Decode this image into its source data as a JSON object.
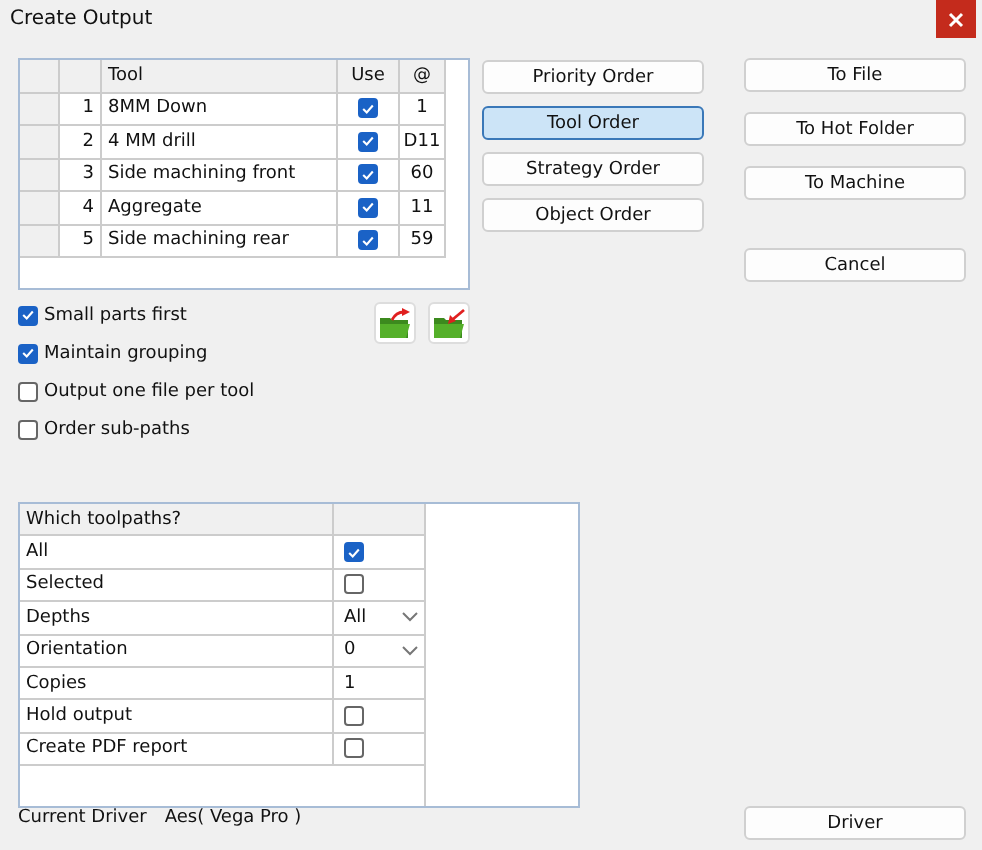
{
  "window": {
    "title": "Create Output"
  },
  "tool_table": {
    "columns": [
      "Tool",
      "Use",
      "@"
    ],
    "rows": [
      {
        "number": "1",
        "tool": "8MM Down",
        "use": true,
        "at": "1"
      },
      {
        "number": "2",
        "tool": "4 MM drill",
        "use": true,
        "at": "D11"
      },
      {
        "number": "3",
        "tool": "Side machining front",
        "use": true,
        "at": "60"
      },
      {
        "number": "4",
        "tool": "Aggregate",
        "use": true,
        "at": "11"
      },
      {
        "number": "5",
        "tool": "Side machining rear",
        "use": true,
        "at": "59"
      }
    ]
  },
  "order_buttons": [
    {
      "label": "Priority Order",
      "selected": false
    },
    {
      "label": "Tool Order",
      "selected": true
    },
    {
      "label": "Strategy Order",
      "selected": false
    },
    {
      "label": "Object Order",
      "selected": false
    }
  ],
  "output_buttons": [
    "To File",
    "To Hot Folder",
    "To Machine"
  ],
  "cancel_button": "Cancel",
  "options": [
    {
      "label": "Small parts first",
      "checked": true
    },
    {
      "label": "Maintain grouping",
      "checked": true
    },
    {
      "label": "Output one file per tool",
      "checked": false
    },
    {
      "label": "Order sub-paths",
      "checked": false
    }
  ],
  "toolpaths": {
    "header": "Which toolpaths?",
    "rows": [
      {
        "kind": "checkbox",
        "label": "All",
        "checked": true
      },
      {
        "kind": "checkbox",
        "label": "Selected",
        "checked": false
      },
      {
        "kind": "dropdown",
        "label": "Depths",
        "value": "All"
      },
      {
        "kind": "dropdown",
        "label": "Orientation",
        "value": "0"
      },
      {
        "kind": "text",
        "label": "Copies",
        "value": "1"
      },
      {
        "kind": "checkbox",
        "label": "Hold output",
        "checked": false
      },
      {
        "kind": "checkbox",
        "label": "Create PDF report",
        "checked": false
      }
    ]
  },
  "driver": {
    "label": "Current Driver",
    "value": "Aes( Vega Pro )"
  },
  "driver_button": "Driver"
}
